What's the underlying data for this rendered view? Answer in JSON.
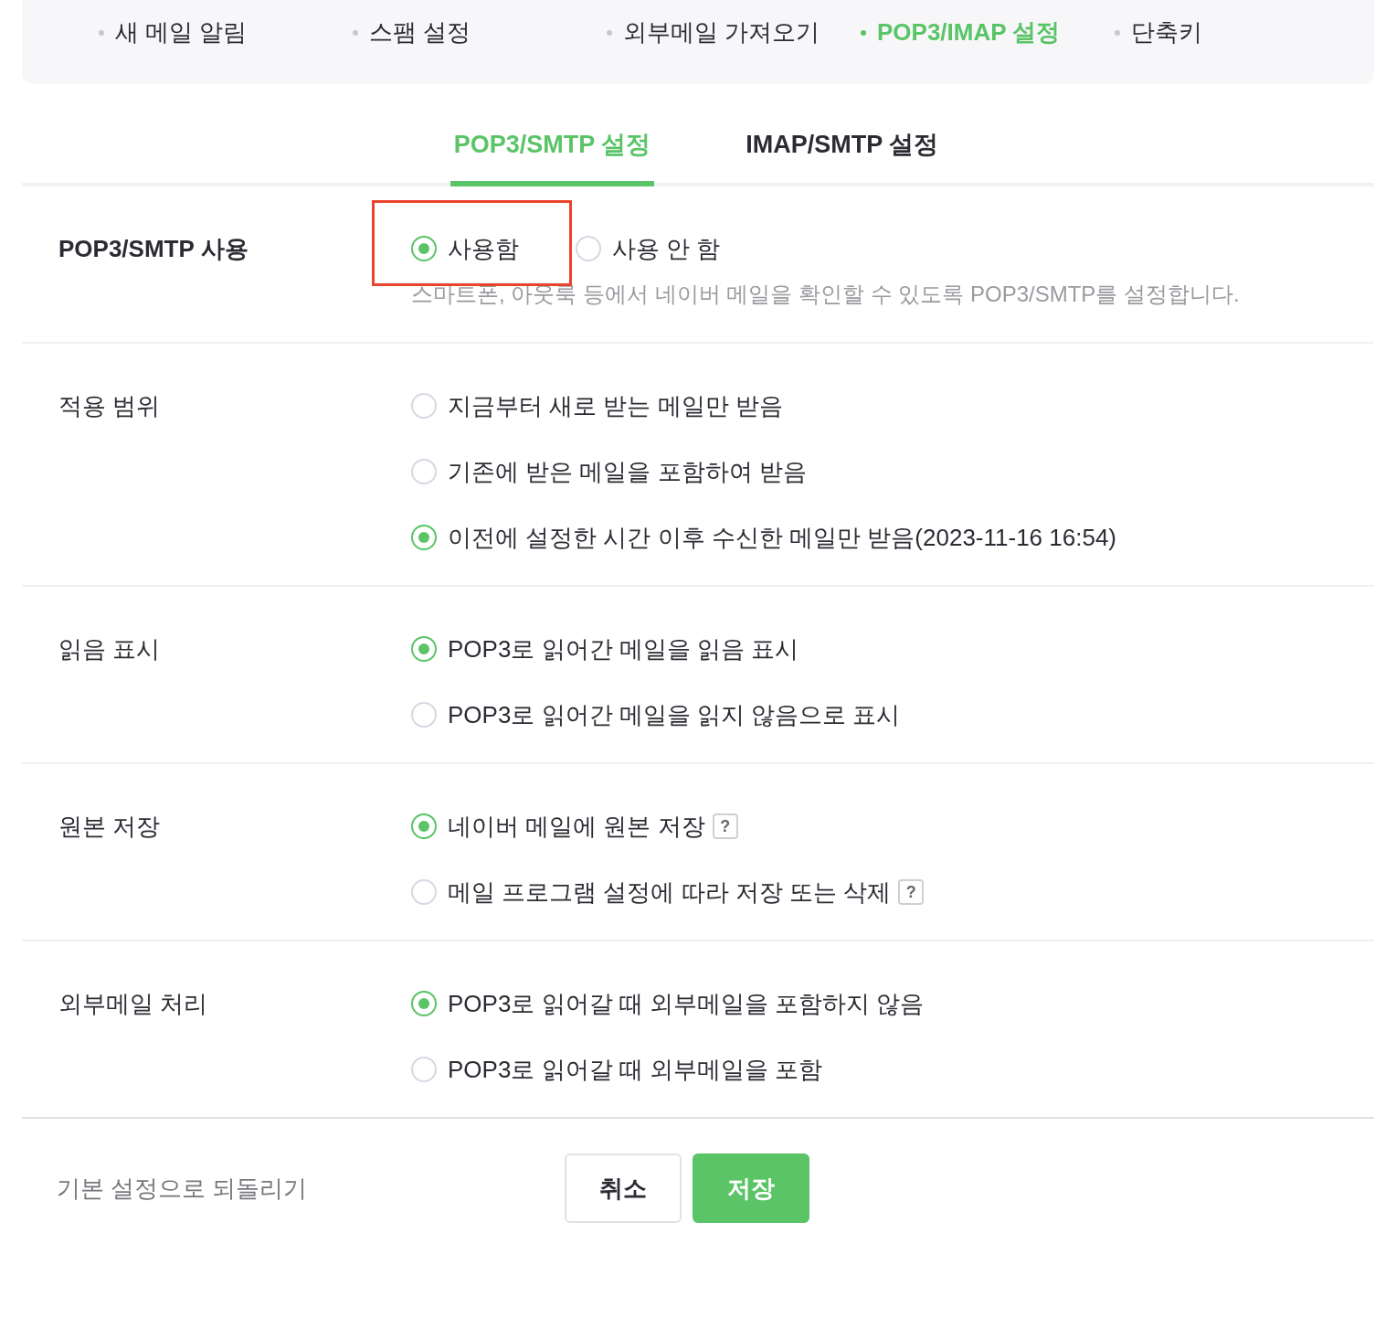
{
  "top_tabs": [
    {
      "label": "새 메일 알림",
      "selected": false
    },
    {
      "label": "스팸 설정",
      "selected": false
    },
    {
      "label": "외부메일 가져오기",
      "selected": false
    },
    {
      "label": "POP3/IMAP 설정",
      "selected": true
    },
    {
      "label": "단축키",
      "selected": false
    }
  ],
  "sub_tabs": [
    {
      "label": "POP3/SMTP 설정",
      "selected": true
    },
    {
      "label": "IMAP/SMTP 설정",
      "selected": false
    }
  ],
  "sections": [
    {
      "label": "POP3/SMTP 사용",
      "kind": "toggle",
      "description": "스마트폰, 아웃룩 등에서 네이버 메일을 확인할 수 있도록 POP3/SMTP를 설정합니다.",
      "options": [
        {
          "label": "사용함",
          "selected": true,
          "highlighted": true
        },
        {
          "label": "사용 안 함",
          "selected": false
        }
      ]
    },
    {
      "label": "적용 범위",
      "kind": "choice",
      "options": [
        {
          "label": "지금부터 새로 받는 메일만 받음",
          "selected": false
        },
        {
          "label": "기존에 받은 메일을 포함하여 받음",
          "selected": false
        },
        {
          "label": "이전에 설정한 시간 이후 수신한 메일만 받음(2023-11-16 16:54)",
          "selected": true
        }
      ]
    },
    {
      "label": "읽음 표시",
      "kind": "choice",
      "options": [
        {
          "label": "POP3로 읽어간 메일을 읽음 표시",
          "selected": true
        },
        {
          "label": "POP3로 읽어간 메일을 읽지 않음으로 표시",
          "selected": false
        }
      ]
    },
    {
      "label": "원본 저장",
      "kind": "choice",
      "options": [
        {
          "label": "네이버 메일에 원본 저장",
          "selected": true,
          "help": "?"
        },
        {
          "label": "메일 프로그램 설정에 따라 저장 또는 삭제",
          "selected": false,
          "help": "?"
        }
      ]
    },
    {
      "label": "외부메일 처리",
      "kind": "choice",
      "options": [
        {
          "label": "POP3로 읽어갈 때 외부메일을 포함하지 않음",
          "selected": true
        },
        {
          "label": "POP3로 읽어갈 때 외부메일을 포함",
          "selected": false
        }
      ]
    }
  ],
  "footer": {
    "reset_link": "기본 설정으로 되돌리기",
    "cancel_button": "취소",
    "save_button": "저장"
  }
}
